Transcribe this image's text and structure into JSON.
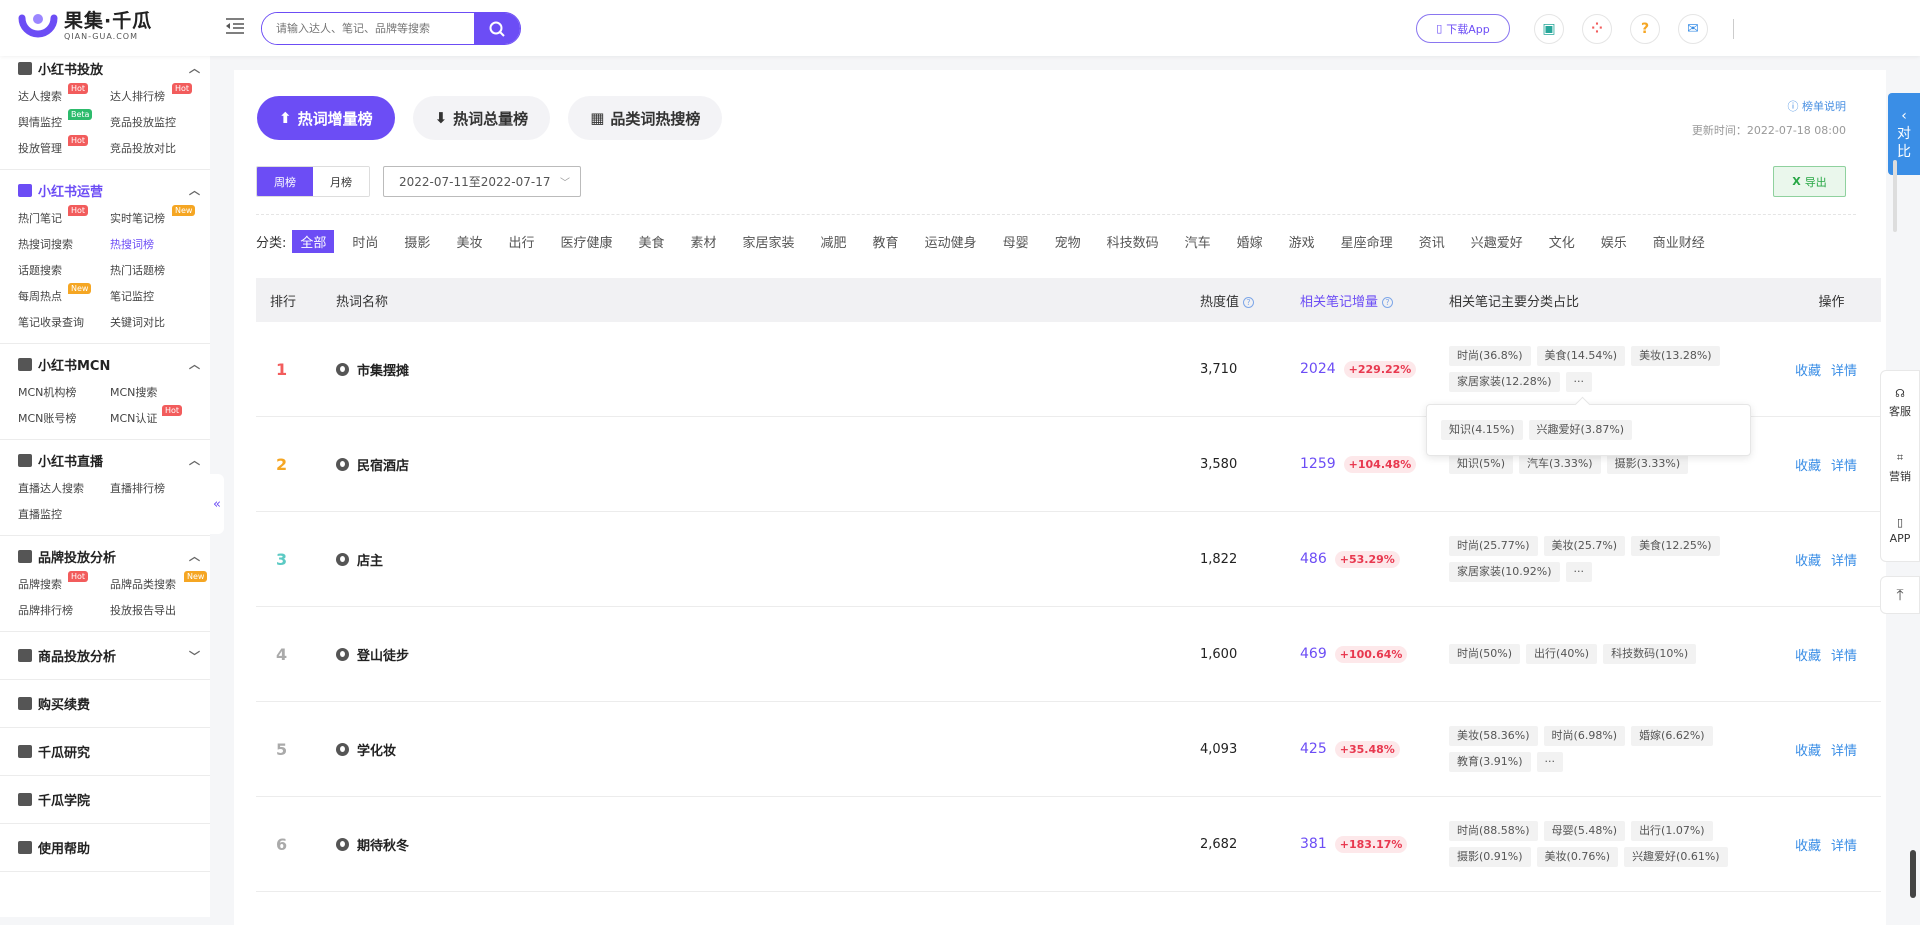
{
  "header": {
    "logo_cn": "果集·千瓜",
    "logo_en": "QIAN-GUA.COM",
    "search_placeholder": "请输入达人、笔记、品牌等搜索",
    "download_app": "下载App",
    "icons": [
      "briefcase-icon",
      "apps-icon",
      "help-icon",
      "mail-icon"
    ]
  },
  "sidebar": {
    "sections": [
      {
        "title": "小红书投放",
        "items": [
          {
            "label": "达人搜索",
            "tag": "Hot"
          },
          {
            "label": "达人排行榜",
            "tag": "Hot"
          },
          {
            "label": "舆情监控",
            "tag": "Beta"
          },
          {
            "label": "竞品投放监控",
            "tag": ""
          },
          {
            "label": "投放管理",
            "tag": "Hot"
          },
          {
            "label": "竞品投放对比",
            "tag": ""
          }
        ]
      },
      {
        "title": "小红书运营",
        "items": [
          {
            "label": "热门笔记",
            "tag": "Hot"
          },
          {
            "label": "实时笔记榜",
            "tag": "New"
          },
          {
            "label": "热搜词搜索",
            "tag": ""
          },
          {
            "label": "热搜词榜",
            "tag": ""
          },
          {
            "label": "话题搜索",
            "tag": ""
          },
          {
            "label": "热门话题榜",
            "tag": ""
          },
          {
            "label": "每周热点",
            "tag": "New"
          },
          {
            "label": "笔记监控",
            "tag": ""
          },
          {
            "label": "笔记收录查询",
            "tag": ""
          },
          {
            "label": "关键词对比",
            "tag": ""
          }
        ]
      },
      {
        "title": "小红书MCN",
        "items": [
          {
            "label": "MCN机构榜",
            "tag": ""
          },
          {
            "label": "MCN搜索",
            "tag": ""
          },
          {
            "label": "MCN账号榜",
            "tag": ""
          },
          {
            "label": "MCN认证",
            "tag": "Hot"
          }
        ]
      },
      {
        "title": "小红书直播",
        "items": [
          {
            "label": "直播达人搜索",
            "tag": ""
          },
          {
            "label": "直播排行榜",
            "tag": ""
          },
          {
            "label": "直播监控",
            "tag": ""
          }
        ]
      },
      {
        "title": "品牌投放分析",
        "items": [
          {
            "label": "品牌搜索",
            "tag": "Hot"
          },
          {
            "label": "品牌品类搜索",
            "tag": "New"
          },
          {
            "label": "品牌排行榜",
            "tag": ""
          },
          {
            "label": "投放报告导出",
            "tag": ""
          }
        ]
      }
    ],
    "singles": [
      "商品投放分析",
      "购买续费",
      "千瓜研究",
      "千瓜学院",
      "使用帮助"
    ]
  },
  "main": {
    "tabs": [
      "热词增量榜",
      "热词总量榜",
      "品类词热搜榜"
    ],
    "explain": "榜单说明",
    "update_time": "更新时间：2022-07-18 08:00",
    "period": [
      "周榜",
      "月榜"
    ],
    "date_range": "2022-07-11至2022-07-17",
    "export": "导出",
    "category_label": "分类:",
    "categories": [
      "全部",
      "时尚",
      "摄影",
      "美妆",
      "出行",
      "医疗健康",
      "美食",
      "素材",
      "家居家装",
      "减肥",
      "教育",
      "运动健身",
      "母婴",
      "宠物",
      "科技数码",
      "汽车",
      "婚嫁",
      "游戏",
      "星座命理",
      "资讯",
      "兴趣爱好",
      "文化",
      "娱乐",
      "商业财经"
    ],
    "columns": [
      "排行",
      "热词名称",
      "热度值",
      "相关笔记增量",
      "相关笔记主要分类占比",
      "操作"
    ],
    "rows": [
      {
        "rank": "1",
        "name": "市集摆摊",
        "heat": "3,710",
        "inc": "2024",
        "pct": "+229.22%",
        "chips": [
          "时尚(36.8%)",
          "美食(14.54%)",
          "美妆(13.28%)",
          "家居家装(12.28%)",
          "···"
        ]
      },
      {
        "rank": "2",
        "name": "民宿酒店",
        "heat": "3,580",
        "inc": "1259",
        "pct": "+104.48%",
        "chips": [
          "知识(5%)",
          "汽车(3.33%)",
          "摄影(3.33%)"
        ]
      },
      {
        "rank": "3",
        "name": "店主",
        "heat": "1,822",
        "inc": "486",
        "pct": "+53.29%",
        "chips": [
          "时尚(25.77%)",
          "美妆(25.7%)",
          "美食(12.25%)",
          "家居家装(10.92%)",
          "···"
        ]
      },
      {
        "rank": "4",
        "name": "登山徒步",
        "heat": "1,600",
        "inc": "469",
        "pct": "+100.64%",
        "chips": [
          "时尚(50%)",
          "出行(40%)",
          "科技数码(10%)"
        ]
      },
      {
        "rank": "5",
        "name": "学化妆",
        "heat": "4,093",
        "inc": "425",
        "pct": "+35.48%",
        "chips": [
          "美妆(58.36%)",
          "时尚(6.98%)",
          "婚嫁(6.62%)",
          "教育(3.91%)",
          "···"
        ]
      },
      {
        "rank": "6",
        "name": "期待秋冬",
        "heat": "2,682",
        "inc": "381",
        "pct": "+183.17%",
        "chips": [
          "时尚(88.58%)",
          "母婴(5.48%)",
          "出行(1.07%)",
          "摄影(0.91%)",
          "美妆(0.76%)",
          "兴趣爱好(0.61%)"
        ]
      }
    ],
    "op_collect": "收藏",
    "op_detail": "详情",
    "popover_chips": [
      "知识(4.15%)",
      "兴趣爱好(3.87%)"
    ],
    "rank_colors": [
      "#f25c5c",
      "#f5a623",
      "#5ccac4",
      "#aaaaaa",
      "#aaaaaa",
      "#aaaaaa"
    ]
  },
  "right_tools": {
    "compare": [
      "对",
      "比"
    ],
    "service": "客服",
    "marketing": "营销",
    "app": "APP"
  }
}
